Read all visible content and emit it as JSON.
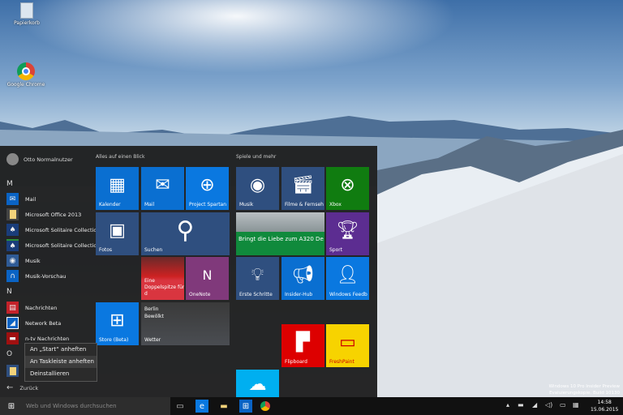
{
  "desktop": {
    "icons": [
      {
        "label": "Papierkorb",
        "icon": "recycle-bin-icon"
      },
      {
        "label": "Google Chrome",
        "icon": "chrome-icon"
      }
    ],
    "watermark": [
      "Windows 10 Pro Insider Preview",
      "Evaluierungskopie. Build 10130"
    ]
  },
  "start": {
    "user": "Otto Normalnutzer",
    "letters": [
      "M",
      "N",
      "O"
    ],
    "apps": [
      {
        "label": "Mail",
        "color": "#0a63c4",
        "icon": "mail-icon"
      },
      {
        "label": "Microsoft Office 2013",
        "color": "#444",
        "icon": "folder-icon",
        "expand": "⌄"
      },
      {
        "label": "Microsoft Solitaire Collection",
        "color": "#1a3d7a",
        "icon": "cards-icon"
      },
      {
        "label": "Microsoft Solitaire Collection...",
        "color": "#1a3d7a",
        "icon": "cards-icon"
      },
      {
        "label": "Musik",
        "color": "#2f5b96",
        "icon": "music-icon"
      },
      {
        "label": "Musik-Vorschau",
        "color": "#0a63c4",
        "icon": "headphones-icon"
      },
      {
        "label": "Nachrichten",
        "color": "#c4222a",
        "icon": "news-icon"
      },
      {
        "label": "Network Beta",
        "color": "#0a63c4",
        "icon": "network-icon"
      },
      {
        "label": "n-tv Nachrichten",
        "color": "#a01010",
        "icon": "ntv-icon"
      }
    ],
    "back": "Zurück",
    "groups": [
      "Alles auf einen Blick",
      "Spiele und mehr"
    ],
    "tiles": {
      "kalender": "Kalender",
      "mail": "Mail",
      "spartan": "Project Spartan",
      "fotos": "Fotos",
      "suchen": "Suchen",
      "news": "Eine Doppelspitze für d",
      "onenote": "OneNote",
      "store": "Store (Beta)",
      "weather_city": "Berlin",
      "weather_cond": "Bewölkt",
      "weather": "Wetter",
      "musik": "Musik",
      "filme": "Filme & Fernseh",
      "xbox": "Xbox",
      "a320": "Bringt die Liebe zum A320 De",
      "sport": "Sport",
      "erste": "Erste Schritte",
      "insider": "Insider-Hub",
      "feedback": "Windows Feedb",
      "flipboard": "Flipboard",
      "freshpaint": "FreshPaint"
    },
    "context_menu": [
      "An „Start“ anheften",
      "An Taskleiste anheften",
      "Deinstallieren"
    ]
  },
  "taskbar": {
    "search_placeholder": "Web und Windows durchsuchen",
    "time": "14:58",
    "date": "15.06.2015"
  },
  "colors": {
    "accent": "#0078d7",
    "tile_dark": "#2f4f7f",
    "xbox": "#107c10",
    "onenote": "#80397b",
    "sport": "#5c2d91",
    "flipboard": "#d00",
    "freshpaint": "#f7d300"
  }
}
